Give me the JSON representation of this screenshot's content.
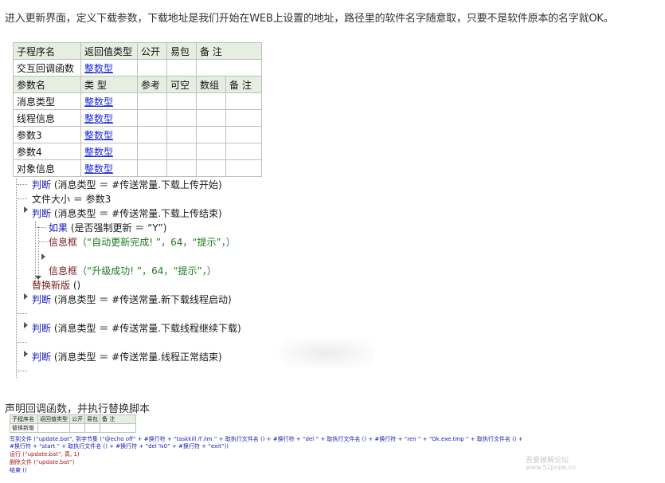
{
  "intro": "进入更新界面，定义下载参数，下载地址是我们开始在WEB上设置的地址，路径里的软件名字随意取，只要不是软件原本的名字就OK。",
  "sig_table": {
    "hdr1": [
      "子程序名",
      "返回值类型",
      "公开",
      "易包",
      "备 注"
    ],
    "row1": [
      "交互回调函数",
      "整数型"
    ],
    "hdr2": [
      "参数名",
      "类 型",
      "参考",
      "可空",
      "数组",
      "备 注"
    ],
    "params": [
      {
        "name": "消息类型",
        "type": "整数型"
      },
      {
        "name": "线程信息",
        "type": "整数型"
      },
      {
        "name": "参数3",
        "type": "整数型"
      },
      {
        "name": "参数4",
        "type": "整数型"
      },
      {
        "name": "对象信息",
        "type": "整数型"
      }
    ]
  },
  "code": {
    "l1": {
      "kw": "判断",
      "rest": " (消息类型 ＝ #传送常量.下载上传开始)"
    },
    "l2": "文件大小 ＝ 参数3",
    "l3": {
      "kw": "判断",
      "rest": " (消息类型 ＝ #传送常量.下载上传结束)"
    },
    "l4": {
      "kw": "如果",
      "rest": " (是否强制更新 ＝ “Y”)"
    },
    "l5": {
      "fn": "信息框",
      "s1": "（“自动更新完成!       ”，64，“提示”，）"
    },
    "l6": {
      "fn": "信息框",
      "s1": "（“升级成功!       ”，64，“提示”，）"
    },
    "l7": {
      "fn": "替换新版",
      "rest": " ()"
    },
    "l8": {
      "kw": "判断",
      "rest": " (消息类型 ＝ #传送常量.新下载线程启动)"
    },
    "l9": {
      "kw": "判断",
      "rest": " (消息类型 ＝ #传送常量.下载线程继续下载)"
    },
    "l10": {
      "kw": "判断",
      "rest": " (消息类型 ＝ #传送常量.线程正常结束)"
    }
  },
  "sec2": "声明回调函数，并执行替换脚本",
  "mini_table": {
    "hdr": [
      "子程序名",
      "返回值类型",
      "公开",
      "易包",
      "备 注"
    ],
    "row": [
      "替换新版"
    ]
  },
  "script": {
    "s1": "写到文件 (“update.bat”, 到字节集 (“@echo off” + #换行符 + “taskkill /f /im ” + 取执行文件名 () + #换行符 + “del ” + 取执行文件名 () + #换行符 + “ren ” + “Ok.exe.tmp ” + 取执行文件名 () +",
    "s2": "#换行符 + “start ” + 取执行文件名 () + #换行符 + “del %0” + #换行符 + “exit”))",
    "s3": "运行 (“update.bat”, 真, 1)",
    "s4": "删除文件 (“update.bat”)",
    "s5": "结束 ()"
  },
  "watermark": {
    "a": "吾爱破解论坛",
    "b": "www.52pojie.cn"
  }
}
